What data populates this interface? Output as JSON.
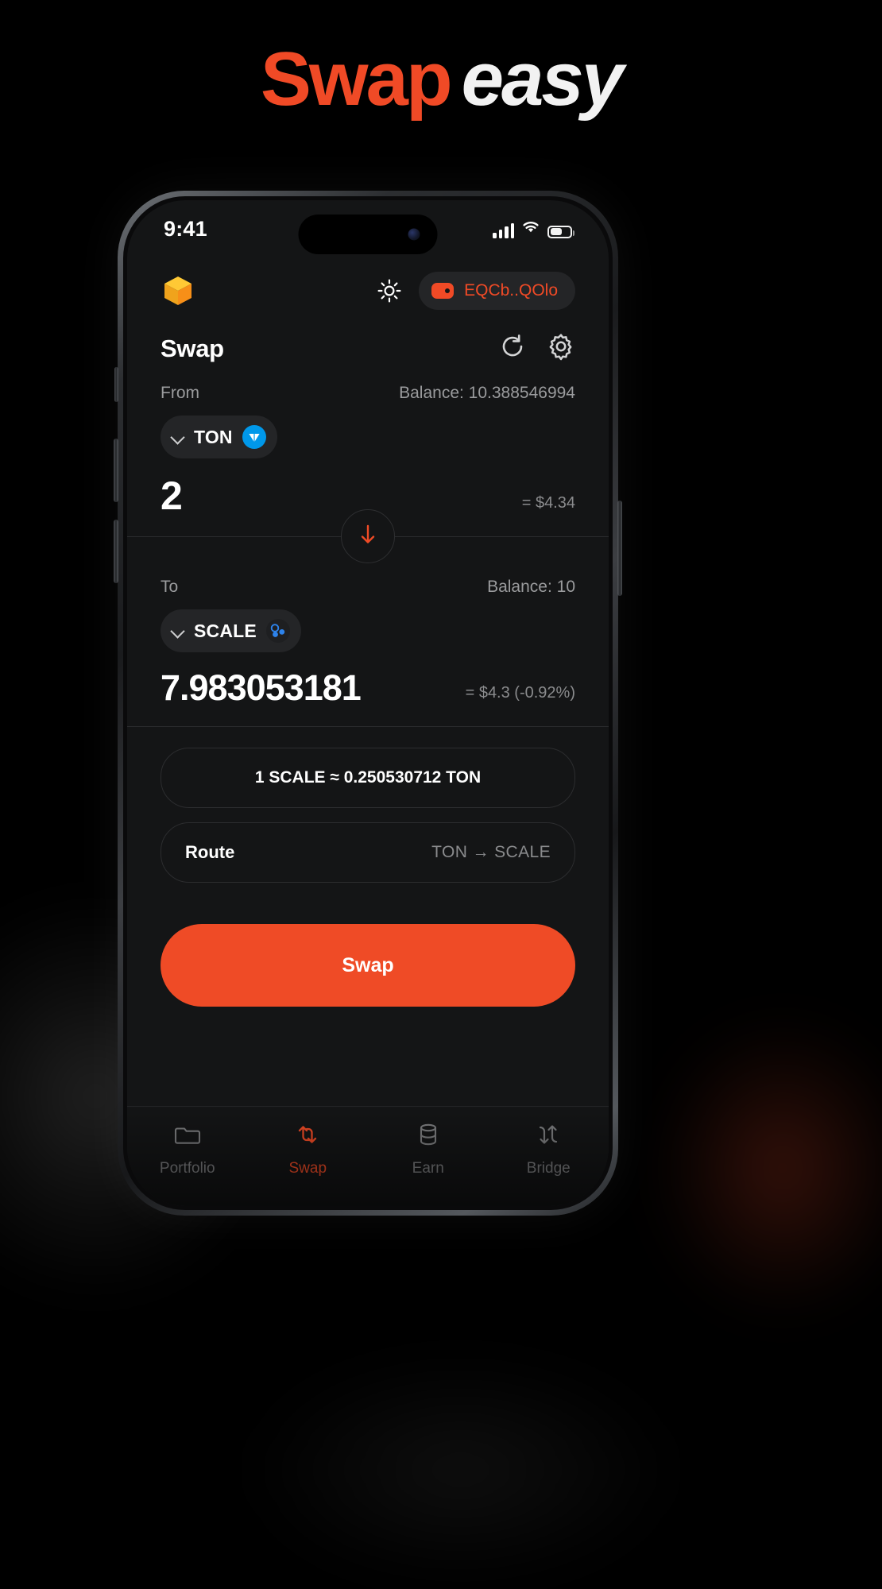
{
  "hero": {
    "word1": "Swap",
    "word2": "easy",
    "accent_color": "#f04a26",
    "word2_color": "#f2f2f2"
  },
  "phone": {
    "status_bar": {
      "time": "9:41",
      "signal_icon": "cellular-signal-icon",
      "wifi_icon": "wifi-icon",
      "battery_icon": "battery-icon",
      "camera_icon": "front-camera-icon"
    },
    "app_header": {
      "logo_icon": "cube-logo-icon",
      "theme_toggle_icon": "sun-icon",
      "wallet": {
        "icon": "wallet-icon",
        "address": "EQCb..QOlo",
        "color": "#f04a26"
      }
    },
    "title_bar": {
      "title": "Swap",
      "refresh_icon": "refresh-icon",
      "settings_icon": "gear-icon"
    },
    "from": {
      "label": "From",
      "balance": "Balance: 10.388546994",
      "token": {
        "symbol": "TON",
        "icon": "ton-token-icon",
        "icon_color": "#0098ea"
      },
      "amount": "2",
      "usd": "= $4.34"
    },
    "switch_icon": "arrow-down-icon",
    "to": {
      "label": "To",
      "balance": "Balance: 10",
      "token": {
        "symbol": "SCALE",
        "icon": "scale-token-icon",
        "icon_color": "#2d83ec"
      },
      "amount": "7.983053181",
      "usd": "= $4.3  (-0.92%)"
    },
    "rate": "1 SCALE ≈ 0.250530712 TON",
    "route": {
      "label": "Route",
      "value": "TON → SCALE"
    },
    "cta_label": "Swap",
    "tabs": [
      {
        "label": "Portfolio",
        "icon": "folder-icon",
        "active": false
      },
      {
        "label": "Swap",
        "icon": "swap-arrows-icon",
        "active": true
      },
      {
        "label": "Earn",
        "icon": "database-icon",
        "active": false
      },
      {
        "label": "Bridge",
        "icon": "bridge-arrows-icon",
        "active": false
      }
    ],
    "accent_color": "#ef4b26"
  }
}
